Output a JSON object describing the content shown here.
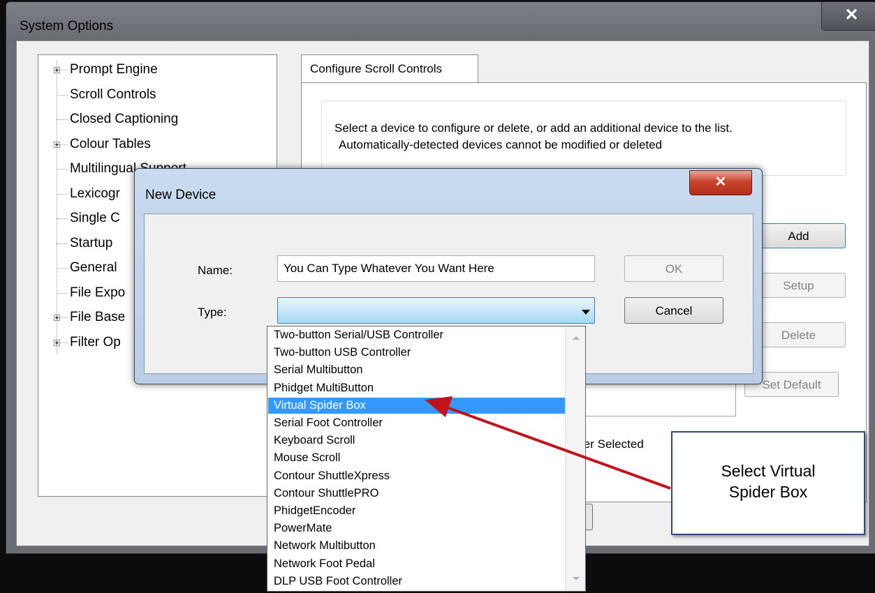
{
  "outer_window": {
    "title": "System Options",
    "close_glyph": "✕"
  },
  "tree": {
    "items": [
      {
        "label": "Prompt Engine",
        "expandable": true
      },
      {
        "label": "Scroll Controls",
        "expandable": false
      },
      {
        "label": "Closed Captioning",
        "expandable": false
      },
      {
        "label": "Colour Tables",
        "expandable": true
      },
      {
        "label": "Multilingual Support",
        "expandable": false
      },
      {
        "label": "Lexicogr",
        "expandable": false
      },
      {
        "label": "Single C",
        "expandable": false
      },
      {
        "label": "Startup",
        "expandable": false
      },
      {
        "label": "General",
        "expandable": false
      },
      {
        "label": "File Expo",
        "expandable": false
      },
      {
        "label": "File Base",
        "expandable": true
      },
      {
        "label": "Filter Op",
        "expandable": true
      }
    ]
  },
  "tab": {
    "label": "Configure Scroll Controls"
  },
  "instructions": {
    "line1": "Select a device to configure or delete, or add an additional device to the list.",
    "line2": "Automatically-detected devices cannot be modified or deleted"
  },
  "buttons": {
    "add": "Add",
    "setup": "Setup",
    "delete": "Delete",
    "set_default": "Set Default"
  },
  "status_text": "ler Selected",
  "new_device_dialog": {
    "title": "New Device",
    "close_glyph": "✕",
    "name_label": "Name:",
    "name_value": "You Can Type Whatever You Want Here",
    "type_label": "Type:",
    "ok_label": "OK",
    "cancel_label": "Cancel"
  },
  "type_dropdown": {
    "selected_index": 4,
    "options": [
      "Two-button Serial/USB Controller",
      "Two-button USB Controller",
      "Serial Multibutton",
      "Phidget MultiButton",
      "Virtual Spider Box",
      "Serial Foot Controller",
      "Keyboard Scroll",
      "Mouse Scroll",
      "Contour ShuttleXpress",
      "Contour ShuttlePRO",
      "PhidgetEncoder",
      "PowerMate",
      "Network Multibutton",
      "Network Foot Pedal",
      "DLP USB Foot Controller"
    ]
  },
  "callout": {
    "line1": "Select Virtual",
    "line2": "Spider Box"
  },
  "colors": {
    "selection": "#3399ff",
    "arrow": "#c0141c",
    "callout_border": "#2b4a7a",
    "dialog_frame": "#c9dbef"
  }
}
